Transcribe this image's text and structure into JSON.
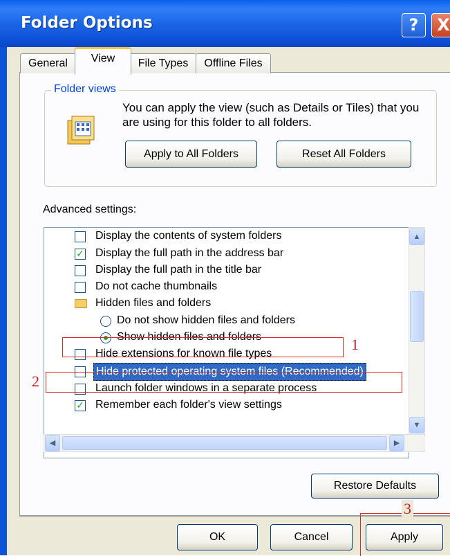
{
  "window": {
    "title": "Folder Options",
    "help_glyph": "?",
    "close_glyph": "X"
  },
  "tabs": [
    {
      "label": "General"
    },
    {
      "label": "View"
    },
    {
      "label": "File Types"
    },
    {
      "label": "Offline Files"
    }
  ],
  "folder_views": {
    "legend": "Folder views",
    "description": "You can apply the view (such as Details or Tiles) that you are using for this folder to all folders.",
    "apply_all_label": "Apply to All Folders",
    "reset_all_label": "Reset All Folders"
  },
  "advanced": {
    "label": "Advanced settings:",
    "items": [
      {
        "type": "checkbox",
        "checked": false,
        "label": "Display the contents of system folders"
      },
      {
        "type": "checkbox",
        "checked": true,
        "label": "Display the full path in the address bar"
      },
      {
        "type": "checkbox",
        "checked": false,
        "label": "Display the full path in the title bar"
      },
      {
        "type": "checkbox",
        "checked": false,
        "label": "Do not cache thumbnails"
      },
      {
        "type": "folder",
        "label": "Hidden files and folders"
      },
      {
        "type": "radio",
        "selected": false,
        "label": "Do not show hidden files and folders"
      },
      {
        "type": "radio",
        "selected": true,
        "label": "Show hidden files and folders"
      },
      {
        "type": "checkbox",
        "checked": false,
        "label": "Hide extensions for known file types"
      },
      {
        "type": "checkbox",
        "checked": false,
        "label": "Hide protected operating system files (Recommended)"
      },
      {
        "type": "checkbox",
        "checked": false,
        "label": "Launch folder windows in a separate process"
      },
      {
        "type": "checkbox",
        "checked": true,
        "label": "Remember each folder's view settings"
      }
    ],
    "restore_defaults_label": "Restore Defaults"
  },
  "annotations": {
    "one": "1",
    "two": "2",
    "three": "3"
  },
  "footer": {
    "ok_label": "OK",
    "cancel_label": "Cancel",
    "apply_label": "Apply"
  },
  "colors": {
    "title_bar": "#0a5fe8",
    "annotation_red": "#d32b2b",
    "selection": "#316ac5",
    "tab_accent": "#ffc83c"
  }
}
